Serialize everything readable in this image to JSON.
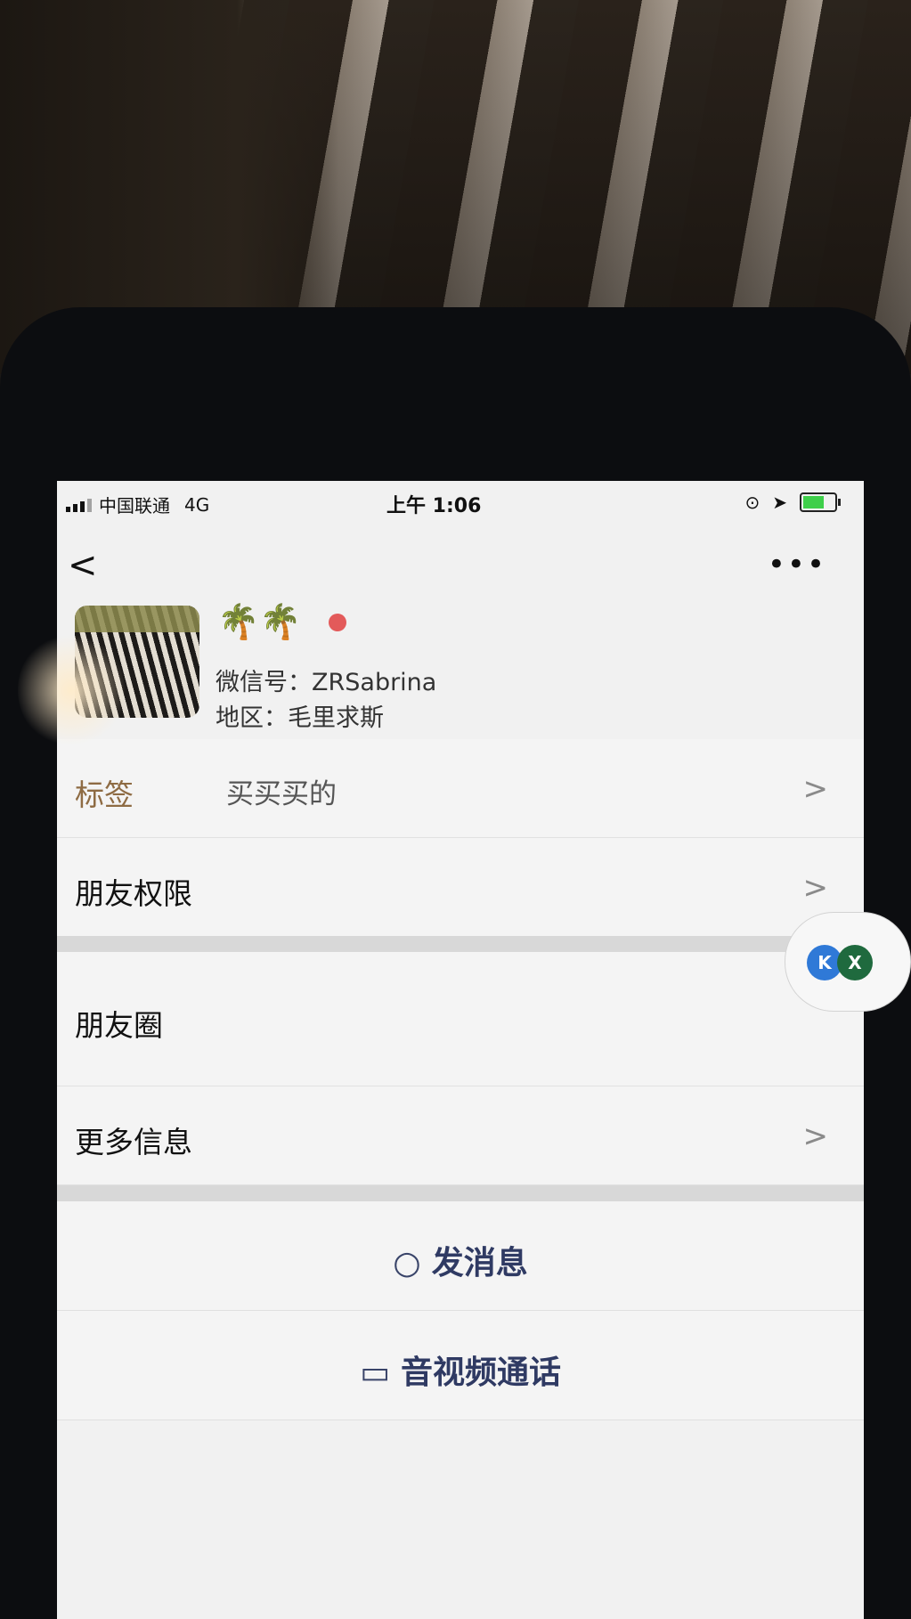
{
  "status_bar": {
    "carrier": "中国联通",
    "network": "4G",
    "time": "上午 1:06"
  },
  "nav": {
    "back_symbol": "<",
    "more_symbol": "•••"
  },
  "profile": {
    "name_emoji": "🌴🌴",
    "wechat_id": "微信号：ZRSabrina",
    "region": "地区：毛里求斯"
  },
  "rows": {
    "tags": {
      "label": "标签",
      "value": "买买买的",
      "chev": ">"
    },
    "permissions": {
      "label": "朋友权限",
      "chev": ">"
    },
    "moments": {
      "label": "朋友圈"
    },
    "more_info": {
      "label": "更多信息",
      "chev": ">"
    }
  },
  "actions": {
    "message": {
      "icon": "○",
      "label": "发消息"
    },
    "call": {
      "icon": "▭",
      "label": "音视频通话"
    }
  },
  "floating": {
    "badge1": "K",
    "badge2": "X"
  }
}
